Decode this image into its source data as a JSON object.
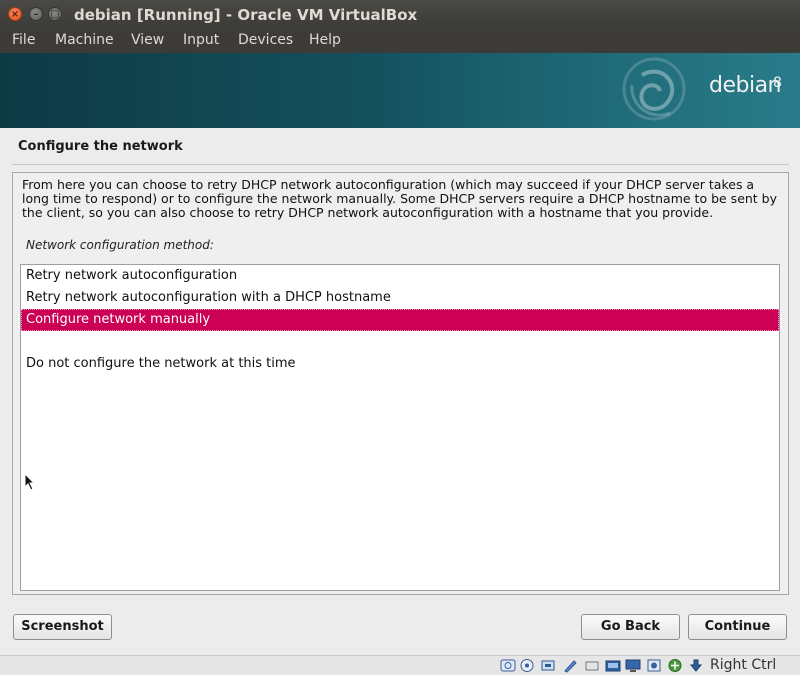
{
  "window": {
    "title": "debian [Running] - Oracle VM VirtualBox"
  },
  "menubar": {
    "items": [
      "File",
      "Machine",
      "View",
      "Input",
      "Devices",
      "Help"
    ]
  },
  "banner": {
    "logo_text": "debian",
    "version": "8"
  },
  "installer": {
    "page_title": "Configure the network",
    "description": "From here you can choose to retry DHCP network autoconfiguration (which may succeed if your DHCP server takes a long time to respond) or to configure the network manually. Some DHCP servers require a DHCP hostname to be sent by the client, so you can also choose to retry DHCP network autoconfiguration with a hostname that you provide.",
    "prompt": "Network configuration method:",
    "options": [
      "Retry network autoconfiguration",
      "Retry network autoconfiguration with a DHCP hostname",
      "Configure network manually",
      "",
      "Do not configure the network at this time"
    ],
    "selected_option": "Configure network manually",
    "buttons": {
      "screenshot": "Screenshot",
      "back": "Go Back",
      "continue": "Continue"
    }
  },
  "statusbar": {
    "host_key": "Right Ctrl",
    "icons": [
      "hard-disk-icon",
      "optical-drive-icon",
      "audio-icon",
      "network-icon",
      "usb-icon",
      "shared-folders-icon",
      "display-icon",
      "video-capture-icon",
      "cpu-icon",
      "mouse-integration-icon",
      "keyboard-capture-icon"
    ]
  },
  "colors": {
    "selection": "#cc0055",
    "banner": "#14505d",
    "titlebar": "#3c3b37"
  }
}
